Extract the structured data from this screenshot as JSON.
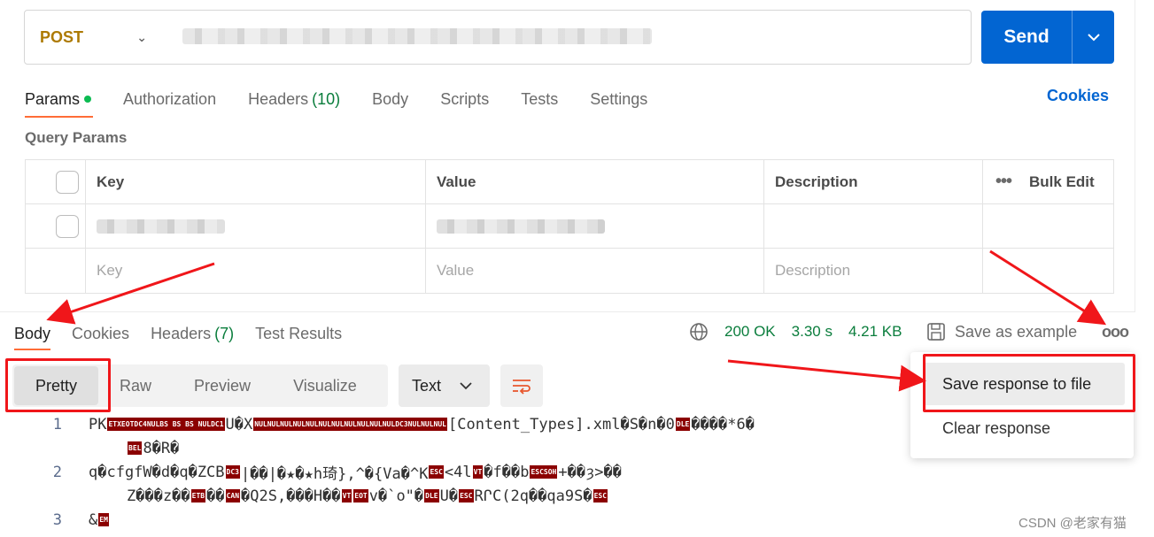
{
  "request": {
    "method": "POST",
    "send_label": "Send"
  },
  "tabs": [
    {
      "label": "Params",
      "active": true,
      "dot": true
    },
    {
      "label": "Authorization"
    },
    {
      "label": "Headers",
      "count": "(10)"
    },
    {
      "label": "Body"
    },
    {
      "label": "Scripts"
    },
    {
      "label": "Tests"
    },
    {
      "label": "Settings"
    }
  ],
  "cookies_link": "Cookies",
  "query_params": {
    "title": "Query Params",
    "headers": {
      "key": "Key",
      "value": "Value",
      "description": "Description",
      "bulk_edit": "Bulk Edit"
    },
    "placeholders": {
      "key": "Key",
      "value": "Value",
      "description": "Description"
    }
  },
  "response": {
    "tabs": [
      {
        "label": "Body",
        "active": true
      },
      {
        "label": "Cookies"
      },
      {
        "label": "Headers",
        "count": "(7)"
      },
      {
        "label": "Test Results"
      }
    ],
    "status": "200 OK",
    "time": "3.30 s",
    "size": "4.21 KB",
    "save_example": "Save as example",
    "views": [
      "Pretty",
      "Raw",
      "Preview",
      "Visualize"
    ],
    "format": "Text",
    "menu": {
      "save_to_file": "Save response to file",
      "clear": "Clear response"
    },
    "lines": [
      {
        "num": "1",
        "a1": "PK",
        "a2": "U�X",
        "a3": "[Content_Types].xml�S�n�0",
        "a4": "����*6�",
        "b1": "8�R�"
      },
      {
        "num": "2",
        "a1": "q�cfgfW�d�q�ZCB",
        "a2": "|��|�★�★h琦},^�{Va�^K",
        "a3": "<4l",
        "a4": "�f��b",
        "a5": "+��ȝ>��",
        "b1": "Z���z��",
        "b2": "��",
        "b3": "�Q2S,���H��",
        "b4": "v�`o\"�",
        "b5": "U�",
        "b6": "RՐC(2q��qa9S�"
      },
      {
        "num": "3",
        "a1": "&"
      }
    ]
  },
  "watermark": "CSDN @老家有猫",
  "colors": {
    "accent": "#ff6c37",
    "send": "#0265d2",
    "method": "#ad7a03",
    "status_ok": "#0a7d3c",
    "annotation": "#f0161a"
  }
}
